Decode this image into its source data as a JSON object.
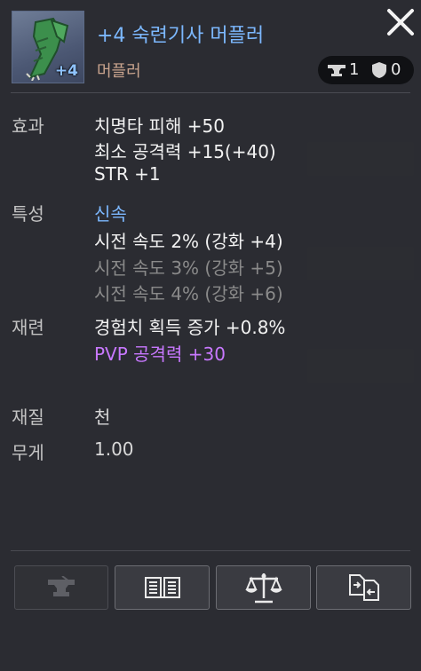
{
  "item": {
    "title": "+4 숙련기사 머플러",
    "type": "머플러",
    "enhance_badge": "+4",
    "anvil_count": "1",
    "shield_count": "0"
  },
  "effects": {
    "label": "효과",
    "lines": [
      "치명타 피해 +50",
      "최소 공격력 +15(+40)",
      "STR +1"
    ]
  },
  "traits": {
    "label": "특성",
    "name": "신속",
    "lines": [
      "시전 속도 2% (강화 +4)",
      "시전 속도 3% (강화 +5)",
      "시전 속도 4% (강화 +6)"
    ]
  },
  "refine": {
    "label": "재련",
    "lines": [
      "경험치 획득 증가 +0.8%",
      "PVP 공격력 +30"
    ]
  },
  "material": {
    "label": "재질",
    "value": "천"
  },
  "weight": {
    "label": "무게",
    "value": "1.00"
  },
  "colors": {
    "title": "#7cb8ff",
    "item_type": "#c9a48e",
    "active": "#f2f2f2",
    "inactive": "#8a8a8a",
    "pvp": "#c878ff"
  },
  "buttons": [
    {
      "icon": "anvil-icon",
      "enabled": false
    },
    {
      "icon": "book-icon",
      "enabled": true
    },
    {
      "icon": "scales-icon",
      "enabled": true
    },
    {
      "icon": "exchange-icon",
      "enabled": true
    }
  ]
}
